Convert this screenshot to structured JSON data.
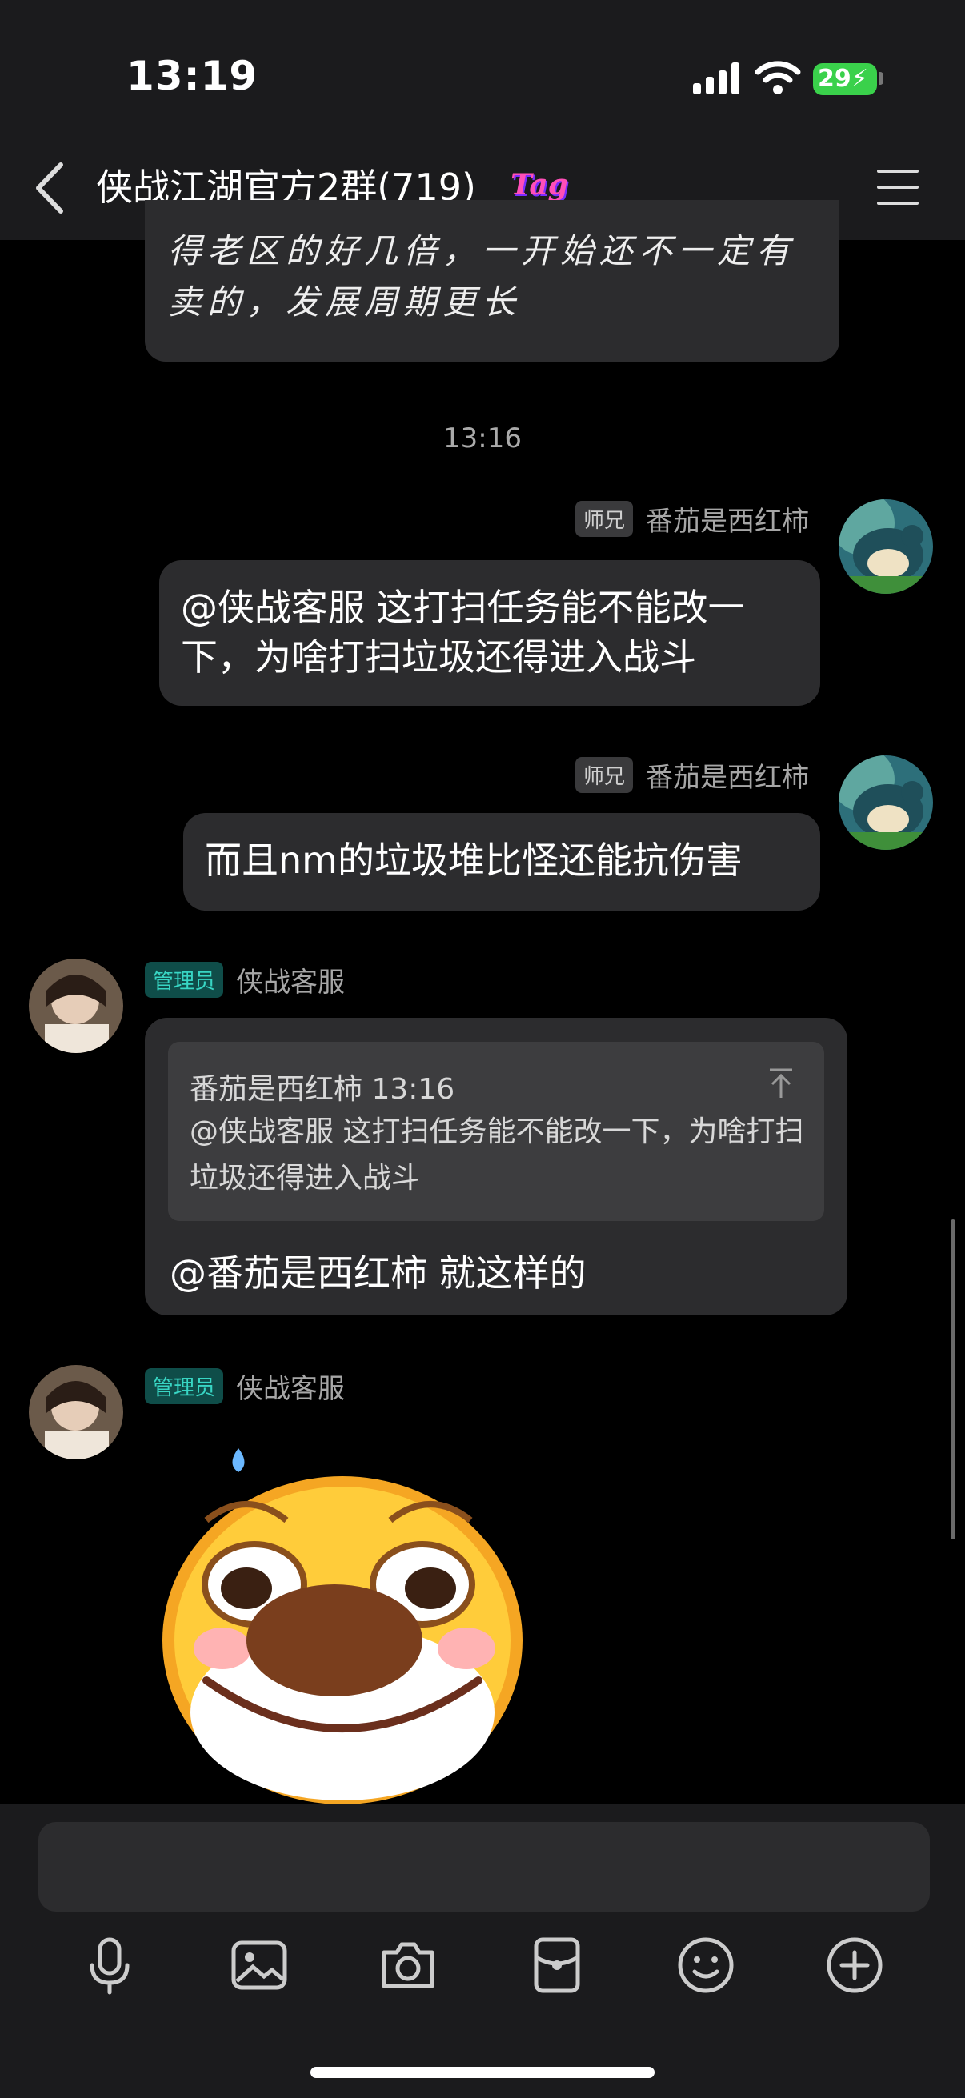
{
  "status_bar": {
    "time": "13:19",
    "battery": "29"
  },
  "header": {
    "title": "侠战江湖官方2群(719)",
    "badge": "Tag"
  },
  "messages": {
    "previous_text": "得老区的好几倍，一开始还不一定有卖的，发展周期更长",
    "timestamp": "13:16",
    "m1": {
      "rank": "师兄",
      "sender": "番茄是西红柿",
      "text": "@侠战客服 这打扫任务能不能改一下，为啥打扫垃圾还得进入战斗"
    },
    "m2": {
      "rank": "师兄",
      "sender": "番茄是西红柿",
      "text": "而且nm的垃圾堆比怪还能抗伤害"
    },
    "m3": {
      "role": "管理员",
      "sender": "侠战客服",
      "quote_head": "番茄是西红柿 13:16",
      "quote_body": "@侠战客服 这打扫任务能不能改一下，为啥打扫垃圾还得进入战斗",
      "text": "@番茄是西红柿 就这样的"
    },
    "m4": {
      "role": "管理员",
      "sender": "侠战客服"
    }
  },
  "input": {
    "placeholder": ""
  },
  "toolbar_icons": [
    "microphone-icon",
    "image-icon",
    "camera-icon",
    "red-packet-icon",
    "emoji-icon",
    "plus-icon"
  ],
  "colors": {
    "admin_badge": "#38d6c4",
    "bubble": "#2c2c2e",
    "battery": "#3ad14b"
  }
}
